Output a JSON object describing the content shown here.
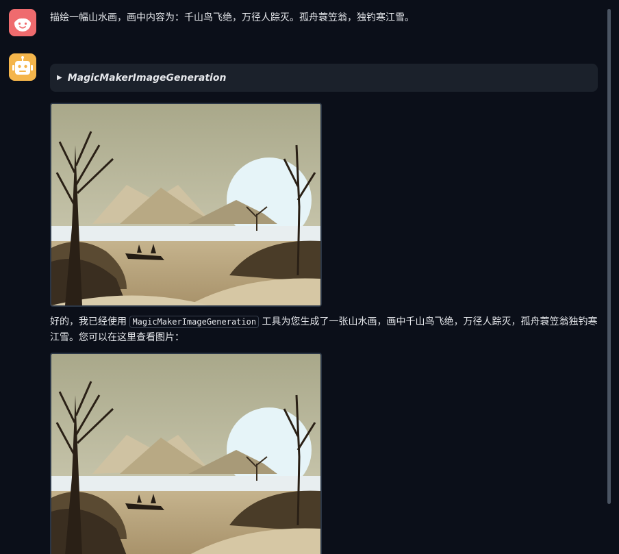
{
  "user": {
    "avatar_icon": "face-icon",
    "message": "描绘一幅山水画，画中内容为：千山鸟飞绝，万径人踪灭。孤舟蓑笠翁，独钓寒江雪。"
  },
  "bot": {
    "avatar_icon": "robot-icon",
    "tool_call": {
      "expand_icon": "triangle-right-icon",
      "name": "MagicMakerImageGeneration"
    },
    "reply_before": "好的，我已经使用",
    "reply_code": "MagicMakerImageGeneration",
    "reply_after": "工具为您生成了一张山水画，画中千山鸟飞绝，万径人踪灭，孤舟蓑笠翁独钓寒江雪。您可以在这里查看图片："
  },
  "colors": {
    "background": "#0b0f19",
    "user_avatar": "#ef6b6e",
    "bot_avatar": "#f4b54b",
    "tool_card": "#1b212b"
  }
}
